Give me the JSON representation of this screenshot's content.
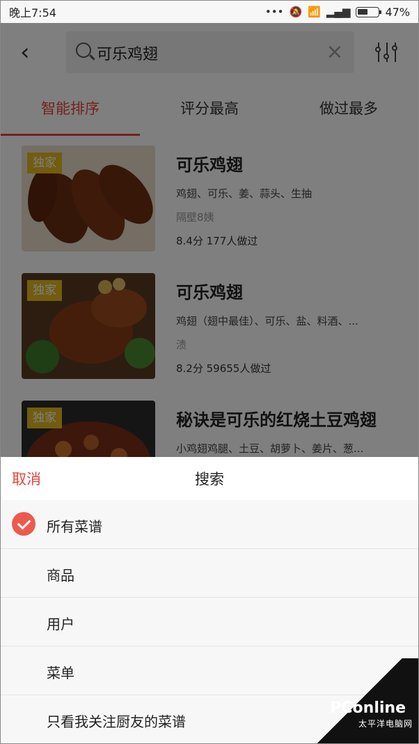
{
  "status_bar": {
    "time": "晚上7:54",
    "battery": "47%"
  },
  "search": {
    "query": "可乐鸡翅"
  },
  "tabs": [
    {
      "label": "智能排序",
      "active": true
    },
    {
      "label": "评分最高",
      "active": false
    },
    {
      "label": "做过最多",
      "active": false
    }
  ],
  "recipes": [
    {
      "badge": "独家",
      "title": "可乐鸡翅",
      "ingredients": "鸡翅、可乐、姜、蒜头、生抽",
      "author": "隔壁8姨",
      "stats": "8.4分 177人做过"
    },
    {
      "badge": "独家",
      "title": "可乐鸡翅",
      "ingredients": "鸡翅（翅中最佳）、可乐、盐、料酒、...",
      "author": "渍",
      "stats": "8.2分 59655人做过"
    },
    {
      "badge": "独家",
      "title": "秘诀是可乐的红烧土豆鸡翅",
      "ingredients": "小鸡翅鸡腿、土豆、胡萝卜、姜片、葱...",
      "author": "",
      "stats": ""
    }
  ],
  "sheet": {
    "cancel_label": "取消",
    "title": "搜索",
    "options": [
      {
        "label": "所有菜谱",
        "selected": true
      },
      {
        "label": "商品",
        "selected": false
      },
      {
        "label": "用户",
        "selected": false
      },
      {
        "label": "菜单",
        "selected": false
      },
      {
        "label": "只看我关注厨友的菜谱",
        "selected": false
      }
    ]
  },
  "watermark": {
    "logo": "PConline",
    "sub": "太平洋电脑网"
  },
  "colors": {
    "accent": "#e8453c",
    "badge": "#e5b81f"
  }
}
